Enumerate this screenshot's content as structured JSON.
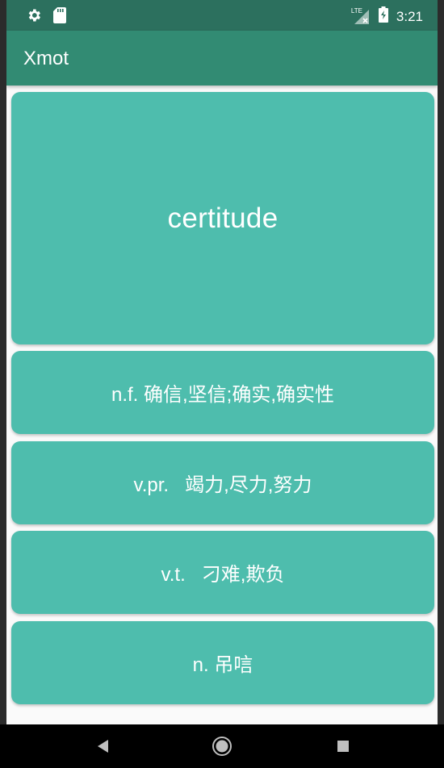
{
  "status_bar": {
    "time": "3:21",
    "network_label": "LTE",
    "left_icons": [
      "gear-icon",
      "sd-card-icon"
    ],
    "right_icons": [
      "signal-icon",
      "battery-charging-icon"
    ]
  },
  "app_bar": {
    "title": "Xmot"
  },
  "quiz": {
    "word": "certitude",
    "options": [
      {
        "pos": "n.f.",
        "meaning": "确信,坚信;确实,确实性",
        "text": "n.f. 确信,坚信;确实,确实性"
      },
      {
        "pos": "v.pr.",
        "meaning": "竭力,尽力,努力",
        "text": "v.pr.   竭力,尽力,努力"
      },
      {
        "pos": "v.t.",
        "meaning": "刁难,欺负",
        "text": "v.t.   刁难,欺负"
      },
      {
        "pos": "n.",
        "meaning": "吊唁",
        "text": "n. 吊唁"
      }
    ]
  },
  "nav_bar": {
    "buttons": [
      "back-icon",
      "home-icon",
      "recents-icon"
    ]
  },
  "colors": {
    "status_bar": "#2c705e",
    "app_bar": "#328b73",
    "card": "#4ebdad",
    "background": "#fafafa",
    "nav_bar": "#000000"
  }
}
